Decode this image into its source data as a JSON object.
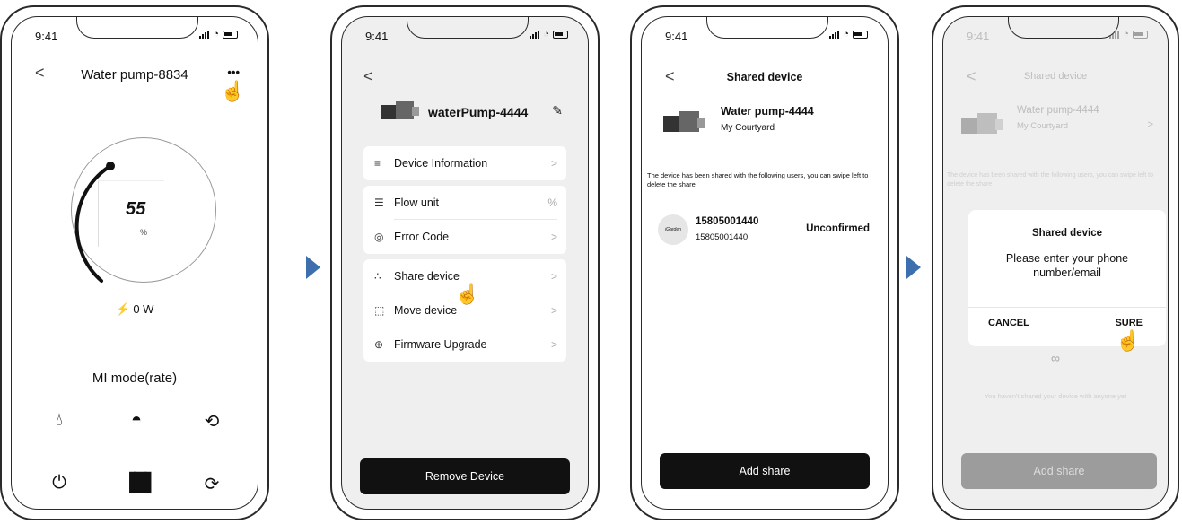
{
  "status": {
    "time": "9:41"
  },
  "phone1": {
    "title": "Water pump-8834",
    "more_label": "•••",
    "gauge_value": "55",
    "gauge_unit": "%",
    "power": "0  W",
    "mode": "MI mode(rate)"
  },
  "phone2": {
    "device_name": "waterPump-4444",
    "menu": [
      {
        "label": "Device Information",
        "value": ">"
      },
      {
        "label": "Flow unit",
        "value": "%"
      },
      {
        "label": "Error Code",
        "value": ">"
      },
      {
        "label": "Share device",
        "value": ">"
      },
      {
        "label": "Move device",
        "value": ">"
      },
      {
        "label": "Firmware Upgrade",
        "value": ">"
      }
    ],
    "remove_label": "Remove Device"
  },
  "phone3": {
    "title": "Shared device",
    "device_name": "Water pump-4444",
    "location": "My Courtyard",
    "notice": "The device has been shared with the following users, you can swipe left to delete the share",
    "avatar_text": "iGarden",
    "user_phone": "15805001440",
    "user_sub": "15805001440",
    "user_status": "Unconfirmed",
    "add_label": "Add share"
  },
  "phone4": {
    "title": "Shared device",
    "device_name": "Water pump-4444",
    "location": "My Courtyard",
    "notice": "The device has been shared with the following users, you can swipe left to delete the share",
    "modal_title": "Shared device",
    "modal_message": "Please enter your phone number/email",
    "cancel_label": "CANCEL",
    "sure_label": "SURE",
    "empty_text": "You haven't shared your device with anyone yet",
    "add_label": "Add share"
  },
  "colors": {
    "accent_arrow": "#3d6fae",
    "button": "#111111"
  }
}
